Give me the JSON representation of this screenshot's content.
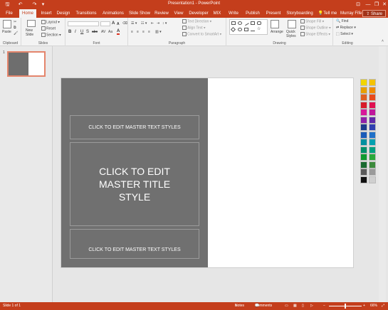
{
  "window": {
    "title": "Presentation1 - PowerPoint",
    "minimize": "—",
    "restore": "❐",
    "close": "✕",
    "ribbon_options": "⊡"
  },
  "quick_access": {
    "save": "🖫",
    "undo": "↶",
    "redo": "↷",
    "customize": "▾"
  },
  "tabs": [
    "File",
    "Home",
    "Insert",
    "Design",
    "Transitions",
    "Animations",
    "Slide Show",
    "Review",
    "View",
    "Developer",
    "MIX",
    "Write",
    "Publish",
    "Present",
    "Storyboarding"
  ],
  "tell_me": "Tell me",
  "user": "Murray Fife",
  "share": "Share",
  "ribbon": {
    "clipboard": {
      "paste": "Paste",
      "label": "Clipboard"
    },
    "slides": {
      "new_slide": "New Slide",
      "layout": "Layout",
      "reset": "Reset",
      "section": "Section",
      "label": "Slides"
    },
    "font": {
      "bold": "B",
      "italic": "I",
      "underline": "U",
      "strike": "S",
      "shadow": "abc",
      "grow": "A",
      "shrink": "A",
      "font_color": "A",
      "label": "Font"
    },
    "paragraph": {
      "text_direction": "Text Direction",
      "align_text": "Align Text",
      "convert": "Convert to SmartArt",
      "label": "Paragraph"
    },
    "drawing": {
      "arrange": "Arrange",
      "quick_styles": "Quick Styles",
      "shape_fill": "Shape Fill",
      "shape_outline": "Shape Outline",
      "shape_effects": "Shape Effects",
      "label": "Drawing"
    },
    "editing": {
      "find": "Find",
      "replace": "Replace",
      "select": "Select",
      "label": "Editing"
    }
  },
  "thumbnail": {
    "number": "1"
  },
  "slide": {
    "top_placeholder": "CLICK TO EDIT MASTER TEXT STYLES",
    "title_placeholder": "CLICK TO EDIT MASTER TITLE STYLE",
    "bottom_placeholder": "CLICK TO EDIT MASTER TEXT STYLES",
    "left_panel_color": "#707070"
  },
  "color_swatches": [
    "#f2d600",
    "#f4c300",
    "#e8a000",
    "#f08a00",
    "#e06020",
    "#e84a1a",
    "#d81b2a",
    "#e01050",
    "#d8189a",
    "#c0169c",
    "#9020a8",
    "#6028a8",
    "#1c3c8c",
    "#3040b0",
    "#1a5ab8",
    "#2070c8",
    "#0090a0",
    "#00a0b0",
    "#00906a",
    "#00a080",
    "#109a30",
    "#2aa83a",
    "#1a6a30",
    "#3c8a3c",
    "#5a5a5a",
    "#9a9a9a",
    "#111111",
    "#cfcfcf"
  ],
  "status": {
    "slide": "Slide 1 of 1",
    "notes": "Notes",
    "comments": "Comments",
    "zoom": "66%"
  },
  "accent": "#c43e1c"
}
